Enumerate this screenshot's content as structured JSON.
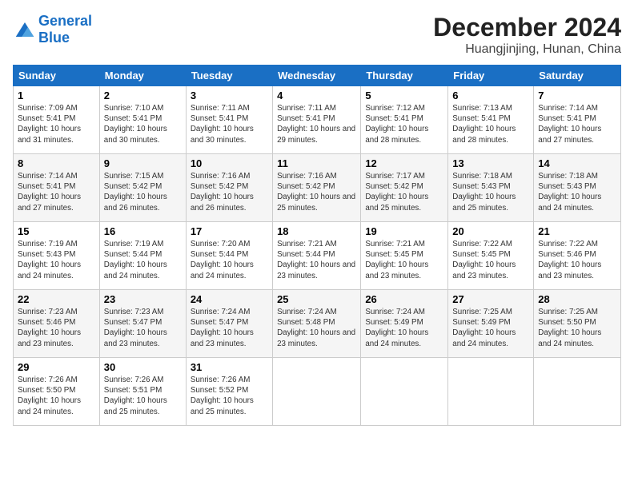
{
  "header": {
    "logo_general": "General",
    "logo_blue": "Blue",
    "month": "December 2024",
    "location": "Huangjinjing, Hunan, China"
  },
  "weekdays": [
    "Sunday",
    "Monday",
    "Tuesday",
    "Wednesday",
    "Thursday",
    "Friday",
    "Saturday"
  ],
  "weeks": [
    [
      {
        "day": "1",
        "sunrise": "7:09 AM",
        "sunset": "5:41 PM",
        "daylight": "10 hours and 31 minutes."
      },
      {
        "day": "2",
        "sunrise": "7:10 AM",
        "sunset": "5:41 PM",
        "daylight": "10 hours and 30 minutes."
      },
      {
        "day": "3",
        "sunrise": "7:11 AM",
        "sunset": "5:41 PM",
        "daylight": "10 hours and 30 minutes."
      },
      {
        "day": "4",
        "sunrise": "7:11 AM",
        "sunset": "5:41 PM",
        "daylight": "10 hours and 29 minutes."
      },
      {
        "day": "5",
        "sunrise": "7:12 AM",
        "sunset": "5:41 PM",
        "daylight": "10 hours and 28 minutes."
      },
      {
        "day": "6",
        "sunrise": "7:13 AM",
        "sunset": "5:41 PM",
        "daylight": "10 hours and 28 minutes."
      },
      {
        "day": "7",
        "sunrise": "7:14 AM",
        "sunset": "5:41 PM",
        "daylight": "10 hours and 27 minutes."
      }
    ],
    [
      {
        "day": "8",
        "sunrise": "7:14 AM",
        "sunset": "5:41 PM",
        "daylight": "10 hours and 27 minutes."
      },
      {
        "day": "9",
        "sunrise": "7:15 AM",
        "sunset": "5:42 PM",
        "daylight": "10 hours and 26 minutes."
      },
      {
        "day": "10",
        "sunrise": "7:16 AM",
        "sunset": "5:42 PM",
        "daylight": "10 hours and 26 minutes."
      },
      {
        "day": "11",
        "sunrise": "7:16 AM",
        "sunset": "5:42 PM",
        "daylight": "10 hours and 25 minutes."
      },
      {
        "day": "12",
        "sunrise": "7:17 AM",
        "sunset": "5:42 PM",
        "daylight": "10 hours and 25 minutes."
      },
      {
        "day": "13",
        "sunrise": "7:18 AM",
        "sunset": "5:43 PM",
        "daylight": "10 hours and 25 minutes."
      },
      {
        "day": "14",
        "sunrise": "7:18 AM",
        "sunset": "5:43 PM",
        "daylight": "10 hours and 24 minutes."
      }
    ],
    [
      {
        "day": "15",
        "sunrise": "7:19 AM",
        "sunset": "5:43 PM",
        "daylight": "10 hours and 24 minutes."
      },
      {
        "day": "16",
        "sunrise": "7:19 AM",
        "sunset": "5:44 PM",
        "daylight": "10 hours and 24 minutes."
      },
      {
        "day": "17",
        "sunrise": "7:20 AM",
        "sunset": "5:44 PM",
        "daylight": "10 hours and 24 minutes."
      },
      {
        "day": "18",
        "sunrise": "7:21 AM",
        "sunset": "5:44 PM",
        "daylight": "10 hours and 23 minutes."
      },
      {
        "day": "19",
        "sunrise": "7:21 AM",
        "sunset": "5:45 PM",
        "daylight": "10 hours and 23 minutes."
      },
      {
        "day": "20",
        "sunrise": "7:22 AM",
        "sunset": "5:45 PM",
        "daylight": "10 hours and 23 minutes."
      },
      {
        "day": "21",
        "sunrise": "7:22 AM",
        "sunset": "5:46 PM",
        "daylight": "10 hours and 23 minutes."
      }
    ],
    [
      {
        "day": "22",
        "sunrise": "7:23 AM",
        "sunset": "5:46 PM",
        "daylight": "10 hours and 23 minutes."
      },
      {
        "day": "23",
        "sunrise": "7:23 AM",
        "sunset": "5:47 PM",
        "daylight": "10 hours and 23 minutes."
      },
      {
        "day": "24",
        "sunrise": "7:24 AM",
        "sunset": "5:47 PM",
        "daylight": "10 hours and 23 minutes."
      },
      {
        "day": "25",
        "sunrise": "7:24 AM",
        "sunset": "5:48 PM",
        "daylight": "10 hours and 23 minutes."
      },
      {
        "day": "26",
        "sunrise": "7:24 AM",
        "sunset": "5:49 PM",
        "daylight": "10 hours and 24 minutes."
      },
      {
        "day": "27",
        "sunrise": "7:25 AM",
        "sunset": "5:49 PM",
        "daylight": "10 hours and 24 minutes."
      },
      {
        "day": "28",
        "sunrise": "7:25 AM",
        "sunset": "5:50 PM",
        "daylight": "10 hours and 24 minutes."
      }
    ],
    [
      {
        "day": "29",
        "sunrise": "7:26 AM",
        "sunset": "5:50 PM",
        "daylight": "10 hours and 24 minutes."
      },
      {
        "day": "30",
        "sunrise": "7:26 AM",
        "sunset": "5:51 PM",
        "daylight": "10 hours and 25 minutes."
      },
      {
        "day": "31",
        "sunrise": "7:26 AM",
        "sunset": "5:52 PM",
        "daylight": "10 hours and 25 minutes."
      },
      null,
      null,
      null,
      null
    ]
  ]
}
